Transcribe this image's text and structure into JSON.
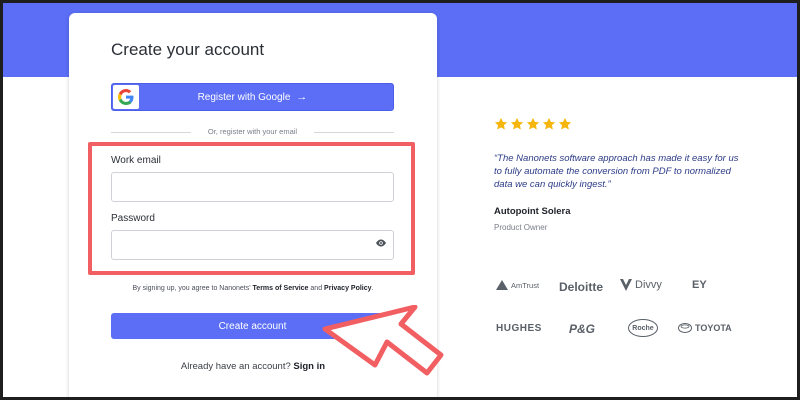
{
  "form": {
    "title": "Create your account",
    "google_button_label": "Register with Google",
    "google_button_arrow": "→",
    "divider_text": "Or, register with your email",
    "email_label": "Work email",
    "email_value": "",
    "password_label": "Password",
    "password_value": "",
    "terms_prefix": "By signing up, you agree to Nanonets'",
    "terms_link": "Terms of Service",
    "terms_and": "and",
    "privacy_link": "Privacy Policy",
    "terms_suffix": ".",
    "create_button_label": "Create account",
    "signin_prefix": "Already have an account?",
    "signin_link": "Sign in"
  },
  "testimonial": {
    "rating": 5,
    "quote": "“The Nanonets software approach has made it easy for us to fully automate the conversion from PDF to normalized data we can quickly ingest.”",
    "author": "Autopoint Solera",
    "role": "Product Owner"
  },
  "logos": {
    "amtrust": "AmTrust",
    "deloitte": "Deloitte",
    "divvy": "Divvy",
    "ey": "EY",
    "hughes": "HUGHES",
    "pg": "P&G",
    "roche": "Roche",
    "toyota": "TOYOTA"
  },
  "colors": {
    "brand": "#5b6ef5",
    "highlight": "#f25f62",
    "star": "#f5b50a"
  }
}
